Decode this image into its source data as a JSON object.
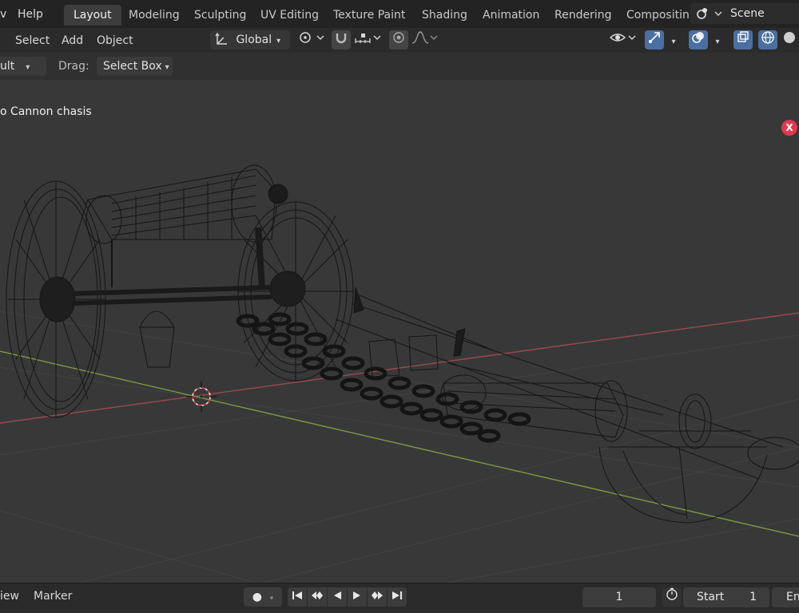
{
  "topbar": {
    "menu_partial": "v",
    "help": "Help",
    "tabs": [
      {
        "label": "Layout",
        "active": true
      },
      {
        "label": "Modeling"
      },
      {
        "label": "Sculpting"
      },
      {
        "label": "UV Editing"
      },
      {
        "label": "Texture Paint"
      },
      {
        "label": "Shading"
      },
      {
        "label": "Animation"
      },
      {
        "label": "Rendering"
      },
      {
        "label": "Compositin"
      }
    ],
    "scene": "Scene"
  },
  "header": {
    "select": "Select",
    "add": "Add",
    "object": "Object",
    "orientation": "Global"
  },
  "tool_header": {
    "mode_partial": "ult",
    "drag_label": "Drag:",
    "drag_value": "Select Box"
  },
  "viewport": {
    "object_info": "o Cannon chasis",
    "close_label": "X"
  },
  "timeline": {
    "view_partial": "iew",
    "marker": "Marker",
    "current_frame": "1",
    "start_label": "Start",
    "start_value": "1",
    "end_partial": "En"
  },
  "colors": {
    "accent": "#4b6fa0",
    "close": "#e0394f",
    "x_axis": "#a3484f",
    "y_axis": "#7a9a3c"
  }
}
